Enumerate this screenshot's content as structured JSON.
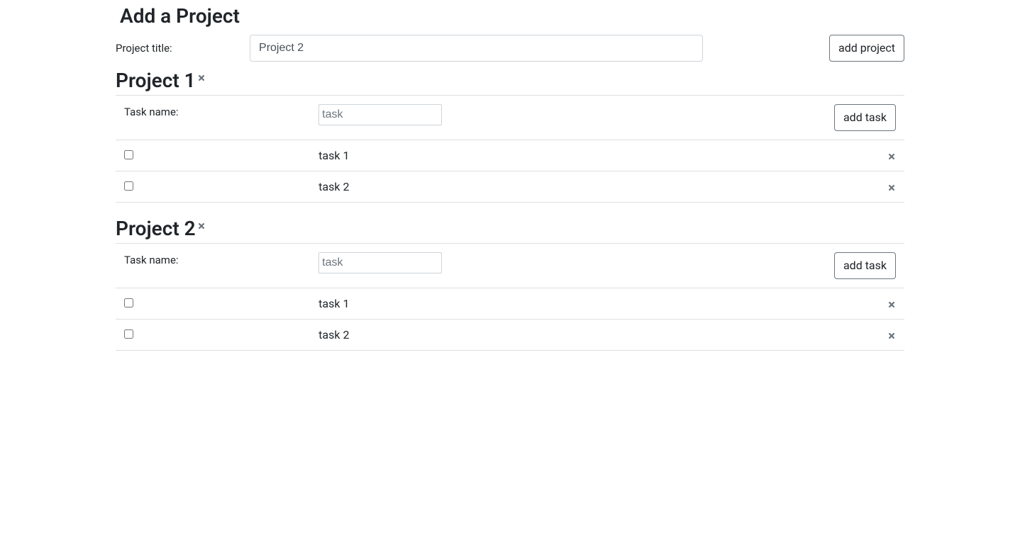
{
  "header": {
    "title": "Add a Project",
    "project_title_label": "Project title:",
    "project_title_value": "Project 2",
    "add_project_button": "add project"
  },
  "task_form": {
    "task_name_label": "Task name:",
    "task_placeholder": "task",
    "add_task_button": "add task"
  },
  "projects": [
    {
      "name": "Project 1",
      "tasks": [
        {
          "name": "task 1",
          "done": false
        },
        {
          "name": "task 2",
          "done": false
        }
      ]
    },
    {
      "name": "Project 2",
      "tasks": [
        {
          "name": "task 1",
          "done": false
        },
        {
          "name": "task 2",
          "done": false
        }
      ]
    }
  ]
}
